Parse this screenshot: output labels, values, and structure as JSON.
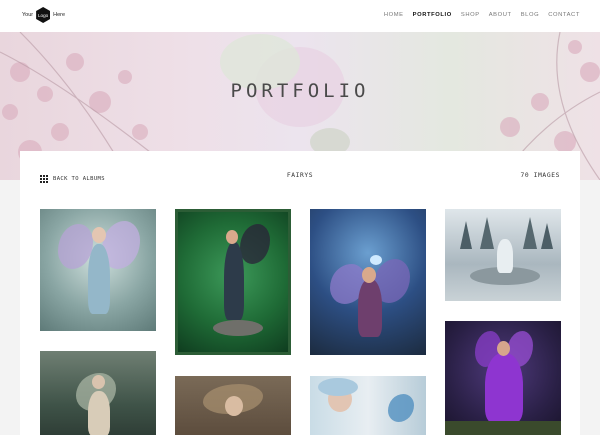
{
  "header": {
    "logo": {
      "prefix": "Your",
      "badge": "Logo",
      "suffix": "Here"
    },
    "nav": [
      {
        "label": "HOME",
        "active": false
      },
      {
        "label": "PORTFOLIO",
        "active": true
      },
      {
        "label": "SHOP",
        "active": false
      },
      {
        "label": "ABOUT",
        "active": false
      },
      {
        "label": "BLOG",
        "active": false
      },
      {
        "label": "CONTACT",
        "active": false
      }
    ]
  },
  "hero": {
    "title": "PORTFOLIO"
  },
  "album": {
    "back_label": "BACK TO ALBUMS",
    "name": "FAIRYS",
    "count": "70 IMAGES"
  }
}
